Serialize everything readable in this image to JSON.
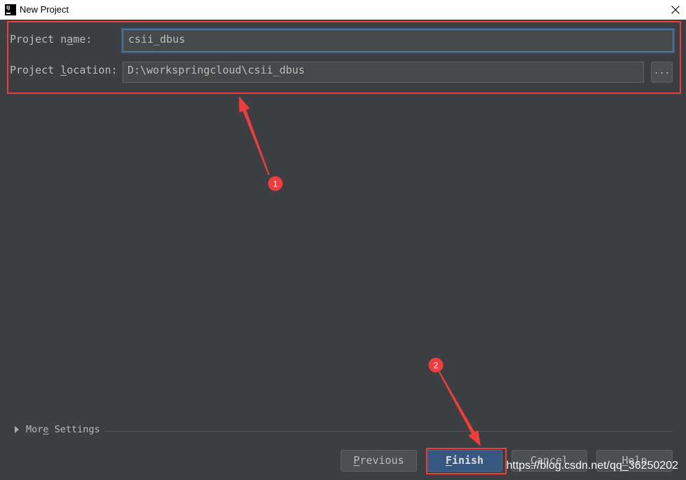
{
  "window": {
    "title": "New Project",
    "app_icon_label": "IJ"
  },
  "form": {
    "project_name": {
      "label": {
        "before": "Project n",
        "mnemonic": "a",
        "after": "me:"
      },
      "value": "csii_dbus",
      "focused": true
    },
    "project_location": {
      "label": {
        "before": "Project ",
        "mnemonic": "l",
        "after": "ocation:"
      },
      "value": "D:\\workspringcloud\\csii_dbus",
      "browse_label": "..."
    }
  },
  "more_settings": {
    "label": {
      "before": "Mor",
      "mnemonic": "e",
      "after": " Settings"
    },
    "expanded": false
  },
  "buttons": {
    "previous": {
      "mnemonic": "P",
      "after": "revious"
    },
    "finish": {
      "mnemonic": "F",
      "after": "inish",
      "is_default": true
    },
    "cancel": {
      "mnemonic": "C",
      "after": "ancel"
    },
    "help": {
      "mnemonic": "H",
      "after": "elp"
    }
  },
  "annotations": {
    "step_1": "1",
    "step_2": "2"
  },
  "watermark": "https://blog.csdn.net/qq_36250202",
  "icons": {
    "app": "intellij-idea-icon",
    "close": "close-icon",
    "more_settings_toggle": "triangle-right-icon"
  },
  "colors": {
    "titlebar_bg": "#ffffff",
    "title_text": "#000000",
    "panel_bg": "#3c3f41",
    "text": "#bbbbbb",
    "field_bg": "#45494a",
    "field_border": "#646464",
    "focus_border": "#5b7fa6",
    "focus_ring": "#3d6185",
    "button_bg": "#4c5052",
    "button_border": "#5e6060",
    "default_button_bg": "#365880",
    "default_button_border": "#4c708c",
    "default_button_text": "#dcdcdc",
    "separator": "#535659",
    "annotation_red": "#f03c3c",
    "watermark_text": "#ffffff"
  }
}
